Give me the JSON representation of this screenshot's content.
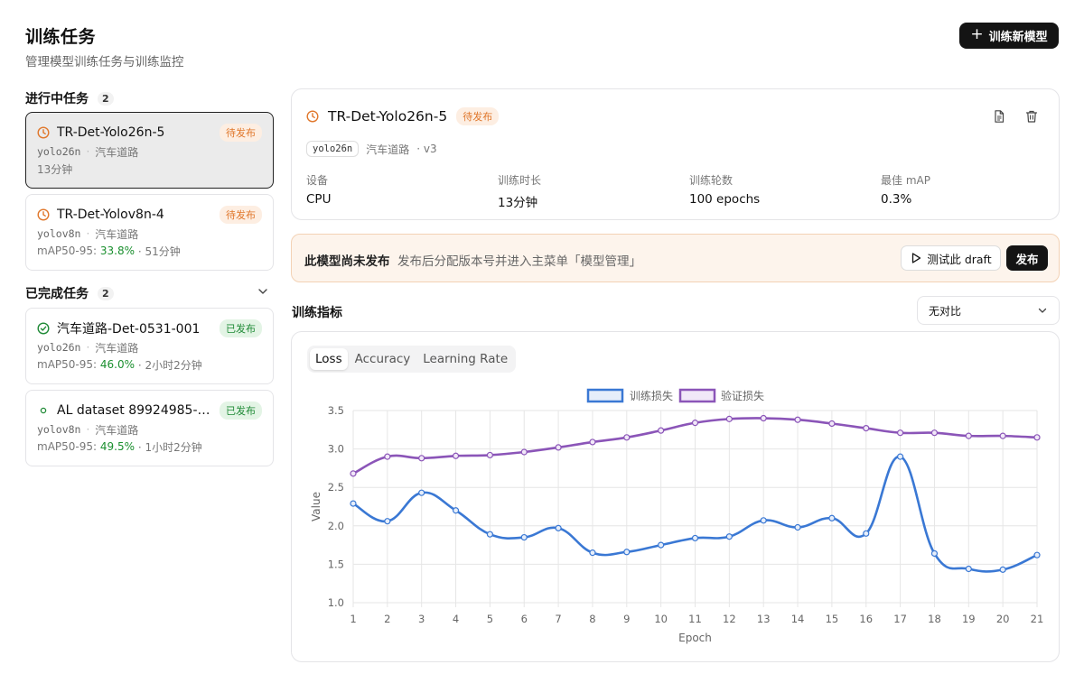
{
  "header": {
    "title": "训练任务",
    "subtitle": "管理模型训练任务与训练监控",
    "new_model_label": "训练新模型"
  },
  "in_progress": {
    "title": "进行中任务",
    "count": "2",
    "tasks": [
      {
        "name": "TR-Det-Yolo26n-5",
        "status": "待发布",
        "model": "yolo26n",
        "dataset": "汽车道路",
        "line3": "13分钟",
        "map_label": "",
        "map_value": "",
        "duration": ""
      },
      {
        "name": "TR-Det-Yolov8n-4",
        "status": "待发布",
        "model": "yolov8n",
        "dataset": "汽车道路",
        "line3": "",
        "map_label": "mAP50-95:",
        "map_value": "33.8%",
        "duration": "· 51分钟"
      }
    ]
  },
  "completed": {
    "title": "已完成任务",
    "count": "2",
    "tasks": [
      {
        "name": "汽车道路-Det-0531-001",
        "status": "已发布",
        "model": "yolo26n",
        "dataset": "汽车道路",
        "map_label": "mAP50-95:",
        "map_value": "46.0%",
        "duration": "· 2小时2分钟"
      },
      {
        "name": "AL dataset 89924985-c1f...",
        "status": "已发布",
        "model": "yolov8n",
        "dataset": "汽车道路",
        "map_label": "mAP50-95:",
        "map_value": "49.5%",
        "duration": "· 1小时2分钟"
      }
    ]
  },
  "detail": {
    "title": "TR-Det-Yolo26n-5",
    "status": "待发布",
    "model_tag": "yolo26n",
    "dataset": "汽车道路",
    "version": "· v3",
    "stats": [
      {
        "label": "设备",
        "value": "CPU"
      },
      {
        "label": "训练时长",
        "value": "13分钟"
      },
      {
        "label": "训练轮数",
        "value": "100 epochs"
      },
      {
        "label": "最佳 mAP",
        "value": "0.3%"
      }
    ]
  },
  "publish_banner": {
    "title": "此模型尚未发布",
    "description": "发布后分配版本号并进入主菜单「模型管理」",
    "test_label": "测试此 draft",
    "publish_label": "发布"
  },
  "metrics": {
    "title": "训练指标",
    "compare_value": "无对比",
    "tabs": [
      "Loss",
      "Accuracy",
      "Learning Rate"
    ],
    "active_tab": "Loss"
  },
  "colors": {
    "train_loss": "#3a78d4",
    "val_loss": "#8b55b8",
    "pending": "#e0772b",
    "published": "#1f8a36"
  },
  "chart_data": {
    "type": "line",
    "xlabel": "Epoch",
    "ylabel": "Value",
    "ylim": [
      1.0,
      3.5
    ],
    "y_ticks": [
      1.0,
      1.5,
      2.0,
      2.5,
      3.0,
      3.5
    ],
    "grid": true,
    "legend_position": "top",
    "x": [
      1,
      2,
      3,
      4,
      5,
      6,
      7,
      8,
      9,
      10,
      11,
      12,
      13,
      14,
      15,
      16,
      17,
      18,
      19,
      20,
      21
    ],
    "series": [
      {
        "name": "训练损失",
        "values": [
          2.29,
          2.06,
          2.43,
          2.2,
          1.89,
          1.85,
          1.97,
          1.65,
          1.66,
          1.75,
          1.84,
          1.86,
          2.07,
          1.98,
          2.1,
          1.9,
          2.9,
          1.64,
          1.44,
          1.43,
          1.62
        ]
      },
      {
        "name": "验证损失",
        "values": [
          2.68,
          2.9,
          2.88,
          2.91,
          2.92,
          2.96,
          3.02,
          3.09,
          3.15,
          3.24,
          3.34,
          3.39,
          3.4,
          3.38,
          3.33,
          3.27,
          3.21,
          3.21,
          3.17,
          3.17,
          3.15
        ]
      }
    ]
  }
}
